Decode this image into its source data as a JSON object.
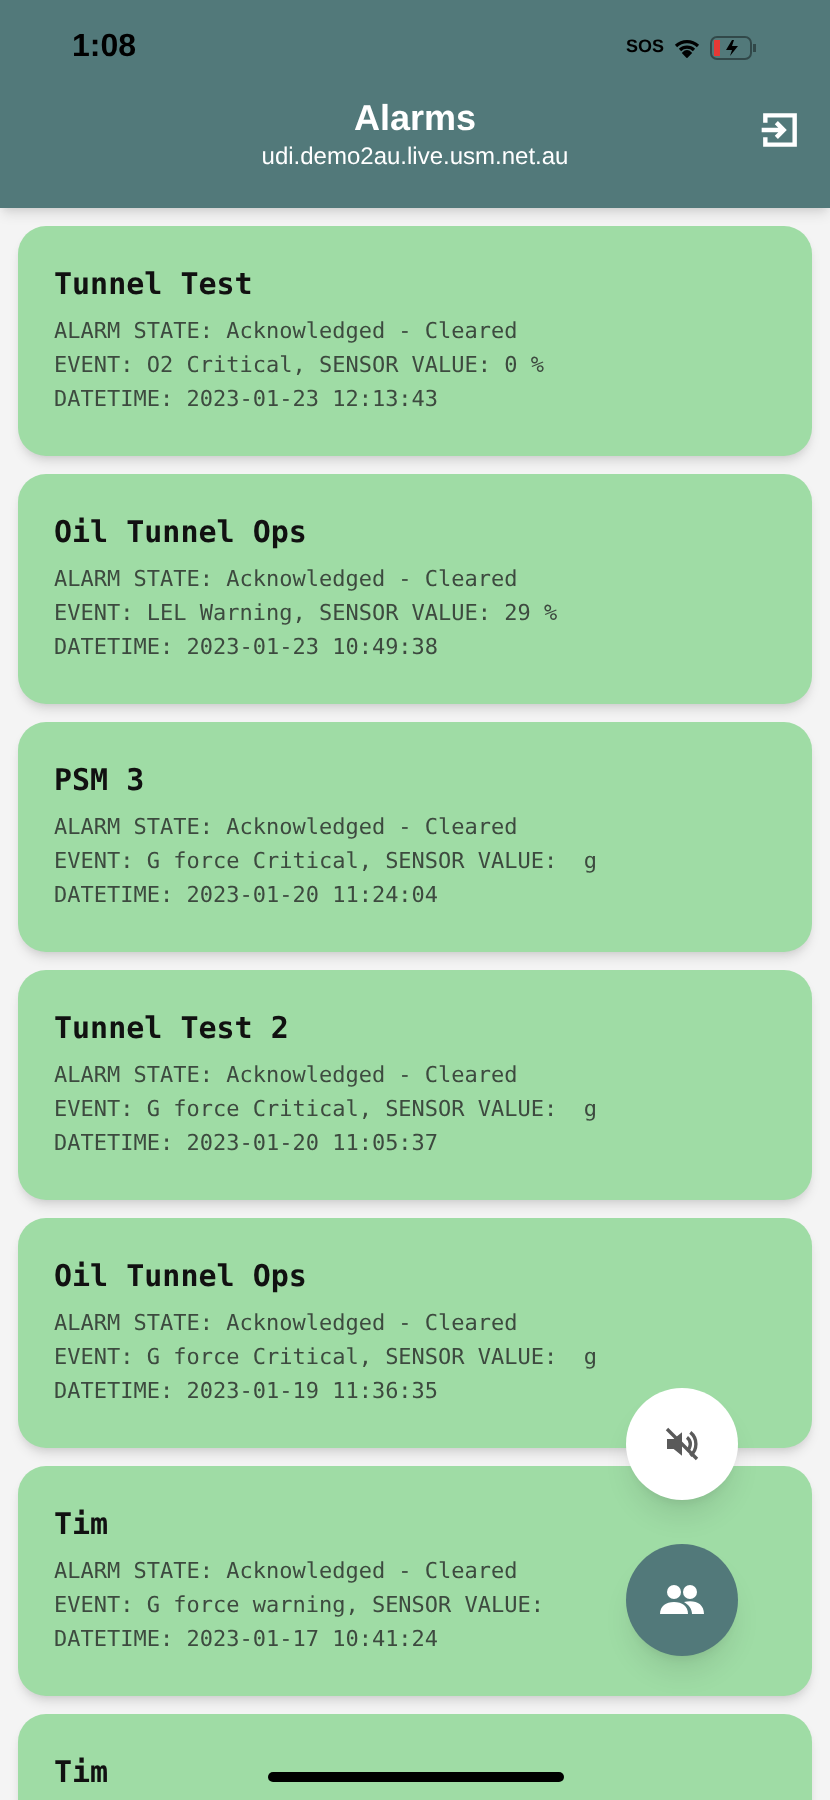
{
  "status_bar": {
    "time": "1:08",
    "carrier": "SOS"
  },
  "app_bar": {
    "title": "Alarms",
    "subtitle": "udi.demo2au.live.usm.net.au"
  },
  "alarms": [
    {
      "name": "Tunnel Test",
      "state": "ALARM STATE: Acknowledged - Cleared",
      "event": "EVENT: O2 Critical, SENSOR VALUE: 0 %",
      "datetime": "DATETIME: 2023-01-23 12:13:43"
    },
    {
      "name": "Oil Tunnel Ops",
      "state": "ALARM STATE: Acknowledged - Cleared",
      "event": "EVENT: LEL Warning, SENSOR VALUE: 29 %",
      "datetime": "DATETIME: 2023-01-23 10:49:38"
    },
    {
      "name": "PSM 3",
      "state": "ALARM STATE: Acknowledged - Cleared",
      "event": "EVENT: G force Critical, SENSOR VALUE:  g",
      "datetime": "DATETIME: 2023-01-20 11:24:04"
    },
    {
      "name": "Tunnel Test 2",
      "state": "ALARM STATE: Acknowledged - Cleared",
      "event": "EVENT: G force Critical, SENSOR VALUE:  g",
      "datetime": "DATETIME: 2023-01-20 11:05:37"
    },
    {
      "name": "Oil Tunnel Ops",
      "state": "ALARM STATE: Acknowledged - Cleared",
      "event": "EVENT: G force Critical, SENSOR VALUE:  g",
      "datetime": "DATETIME: 2023-01-19 11:36:35"
    },
    {
      "name": "Tim",
      "state": "ALARM STATE: Acknowledged - Cleared",
      "event": "EVENT: G force warning, SENSOR VALUE:",
      "datetime": "DATETIME: 2023-01-17 10:41:24"
    },
    {
      "name": "Tim"
    }
  ]
}
